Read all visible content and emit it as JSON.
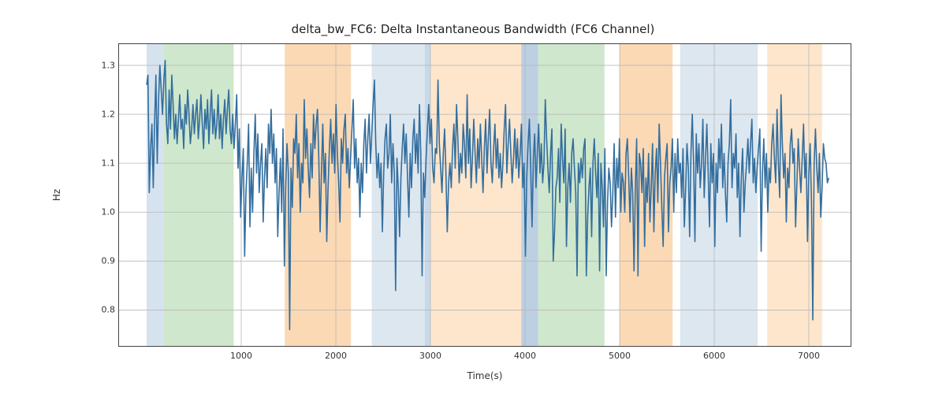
{
  "chart_data": {
    "type": "line",
    "title": "delta_bw_FC6: Delta Instantaneous Bandwidth (FC6 Channel)",
    "xlabel": "Time(s)",
    "ylabel": "Hz",
    "xlim": [
      -300,
      7450
    ],
    "ylim": [
      0.725,
      1.345
    ],
    "xticks": [
      1000,
      2000,
      3000,
      4000,
      5000,
      6000,
      7000
    ],
    "yticks": [
      0.8,
      0.9,
      1.0,
      1.1,
      1.2,
      1.3
    ],
    "grid": true,
    "bands": [
      {
        "x0": 0,
        "x1": 180,
        "color": "#d6e3ef",
        "alpha": 1.0
      },
      {
        "x0": 180,
        "x1": 920,
        "color": "#cfe7cc",
        "alpha": 1.0
      },
      {
        "x0": 1460,
        "x1": 2160,
        "color": "#fbd9b5",
        "alpha": 1.0
      },
      {
        "x0": 2380,
        "x1": 2940,
        "color": "#dde7f0",
        "alpha": 1.0
      },
      {
        "x0": 2940,
        "x1": 3000,
        "color": "#c8d8e8",
        "alpha": 1.0
      },
      {
        "x0": 3000,
        "x1": 3960,
        "color": "#fde6cc",
        "alpha": 1.0
      },
      {
        "x0": 3960,
        "x1": 4140,
        "color": "#bcd0e2",
        "alpha": 1.0
      },
      {
        "x0": 4140,
        "x1": 4840,
        "color": "#cfe7cc",
        "alpha": 1.0
      },
      {
        "x0": 5000,
        "x1": 5560,
        "color": "#fbd9b5",
        "alpha": 1.0
      },
      {
        "x0": 5640,
        "x1": 6460,
        "color": "#dde7f0",
        "alpha": 1.0
      },
      {
        "x0": 6560,
        "x1": 7140,
        "color": "#fde6cc",
        "alpha": 1.0
      }
    ],
    "series": [
      {
        "name": "delta_bw_FC6",
        "color": "#336e9e",
        "x_start": 0,
        "x_step": 14,
        "y": [
          1.26,
          1.28,
          1.04,
          1.13,
          1.18,
          1.05,
          1.18,
          1.28,
          1.1,
          1.23,
          1.3,
          1.25,
          1.2,
          1.27,
          1.31,
          1.18,
          1.14,
          1.25,
          1.17,
          1.28,
          1.22,
          1.15,
          1.2,
          1.14,
          1.19,
          1.24,
          1.17,
          1.19,
          1.13,
          1.22,
          1.18,
          1.25,
          1.2,
          1.14,
          1.17,
          1.22,
          1.16,
          1.2,
          1.23,
          1.15,
          1.19,
          1.24,
          1.18,
          1.13,
          1.21,
          1.17,
          1.23,
          1.14,
          1.2,
          1.25,
          1.16,
          1.21,
          1.15,
          1.18,
          1.24,
          1.15,
          1.2,
          1.13,
          1.19,
          1.23,
          1.16,
          1.21,
          1.25,
          1.17,
          1.14,
          1.2,
          1.13,
          1.18,
          1.24,
          1.09,
          1.17,
          0.99,
          1.07,
          1.13,
          0.91,
          1.04,
          1.1,
          1.18,
          0.97,
          1.09,
          1.0,
          1.12,
          1.2,
          1.08,
          1.16,
          1.04,
          1.1,
          1.14,
          0.98,
          1.07,
          1.13,
          1.05,
          1.18,
          1.12,
          1.21,
          1.1,
          1.16,
          1.06,
          1.13,
          0.95,
          1.04,
          1.11,
          1.0,
          1.17,
          0.89,
          1.05,
          1.14,
          1.08,
          0.76,
          1.09,
          1.01,
          1.15,
          1.12,
          1.2,
          1.07,
          1.14,
          1.0,
          1.1,
          1.06,
          1.23,
          1.11,
          1.17,
          1.09,
          1.03,
          1.14,
          1.07,
          1.2,
          1.13,
          1.18,
          1.21,
          1.11,
          0.96,
          1.08,
          1.18,
          1.06,
          1.12,
          0.94,
          1.05,
          1.13,
          1.19,
          1.1,
          1.16,
          1.08,
          1.22,
          1.12,
          1.06,
          0.98,
          1.15,
          1.1,
          1.17,
          1.2,
          1.08,
          1.13,
          1.05,
          1.11,
          1.17,
          1.23,
          1.09,
          1.15,
          1.06,
          1.11,
          0.99,
          1.1,
          1.04,
          1.14,
          1.19,
          1.08,
          1.15,
          1.2,
          1.1,
          1.16,
          1.22,
          1.27,
          1.14,
          1.07,
          1.12,
          1.05,
          1.1,
          0.96,
          1.08,
          1.15,
          1.18,
          1.09,
          1.12,
          1.2,
          1.06,
          1.14,
          1.08,
          0.84,
          1.11,
          1.05,
          0.95,
          1.07,
          1.13,
          1.18,
          1.1,
          1.16,
          1.07,
          0.99,
          1.12,
          1.05,
          1.15,
          1.19,
          1.1,
          1.16,
          1.08,
          1.22,
          1.12,
          0.87,
          1.08,
          1.03,
          1.11,
          1.17,
          1.22,
          1.14,
          1.19,
          1.09,
          1.06,
          1.13,
          1.12,
          1.27,
          1.14,
          1.09,
          1.04,
          1.12,
          1.17,
          1.08,
          0.96,
          1.06,
          1.1,
          1.05,
          1.13,
          1.18,
          1.09,
          1.22,
          1.15,
          1.06,
          1.12,
          1.08,
          1.18,
          1.14,
          1.07,
          1.24,
          1.1,
          1.17,
          1.05,
          1.11,
          1.19,
          1.12,
          1.06,
          1.15,
          1.09,
          1.18,
          1.11,
          1.04,
          1.13,
          1.19,
          1.08,
          1.15,
          1.21,
          1.1,
          1.06,
          1.13,
          1.18,
          1.09,
          1.15,
          1.07,
          1.12,
          1.05,
          1.1,
          1.17,
          1.22,
          1.08,
          1.14,
          1.19,
          1.12,
          1.06,
          1.11,
          1.17,
          1.09,
          1.15,
          1.07,
          1.12,
          1.18,
          1.05,
          1.1,
          0.91,
          1.07,
          1.14,
          1.19,
          1.09,
          0.97,
          1.11,
          1.16,
          1.05,
          1.12,
          1.18,
          1.08,
          1.14,
          1.06,
          1.1,
          1.23,
          1.15,
          1.09,
          1.04,
          1.12,
          1.17,
          0.9,
          0.96,
          1.05,
          1.07,
          1.13,
          1.02,
          1.18,
          1.11,
          1.06,
          1.17,
          0.93,
          1.05,
          1.1,
          1.02,
          1.12,
          1.15,
          1.09,
          1.04,
          0.87,
          1.1,
          1.06,
          1.11,
          1.07,
          1.13,
          1.15,
          0.87,
          0.99,
          1.05,
          1.09,
          0.95,
          1.1,
          1.15,
          1.08,
          1.03,
          1.12,
          0.88,
          1.1,
          1.05,
          0.97,
          1.13,
          0.87,
          1.02,
          1.09,
          1.06,
          0.97,
          1.04,
          1.14,
          0.99,
          1.11,
          1.05,
          1.15,
          1.0,
          1.08,
          1.06,
          1.0,
          1.12,
          1.15,
          1.07,
          0.98,
          1.09,
          1.04,
          0.88,
          1.05,
          1.15,
          0.87,
          1.12,
          1.1,
          1.04,
          1.13,
          0.93,
          1.07,
          1.02,
          1.12,
          0.98,
          1.05,
          1.14,
          0.96,
          1.08,
          1.13,
          1.02,
          1.18,
          1.1,
          1.01,
          0.93,
          1.07,
          1.11,
          1.14,
          0.96,
          1.06,
          1.09,
          1.15,
          1.0,
          1.12,
          1.04,
          1.15,
          1.08,
          1.1,
          1.03,
          1.13,
          0.97,
          1.05,
          1.14,
          1.09,
          0.95,
          1.12,
          1.2,
          1.1,
          0.94,
          1.16,
          1.08,
          1.14,
          1.05,
          1.1,
          1.19,
          1.03,
          1.11,
          1.18,
          1.08,
          0.97,
          1.14,
          1.06,
          1.12,
          0.93,
          1.1,
          1.04,
          1.15,
          1.09,
          1.18,
          1.05,
          1.12,
          1.04,
          0.98,
          1.1,
          1.14,
          1.23,
          1.05,
          1.12,
          1.09,
          1.16,
          1.03,
          1.1,
          0.95,
          1.07,
          1.13,
          1.0,
          1.06,
          1.1,
          1.15,
          1.08,
          1.14,
          1.19,
          1.06,
          1.11,
          1.04,
          1.09,
          1.13,
          1.17,
          0.92,
          1.08,
          1.15,
          1.05,
          1.12,
          1.0,
          1.09,
          1.06,
          1.14,
          1.18,
          1.11,
          1.06,
          1.21,
          1.1,
          1.03,
          1.24,
          1.14,
          1.07,
          1.12,
          0.98,
          1.09,
          1.05,
          1.14,
          1.17,
          1.1,
          1.13,
          0.97,
          1.06,
          1.15,
          1.09,
          1.04,
          1.11,
          1.18,
          1.07,
          1.12,
          0.94,
          1.08,
          1.14,
          1.02,
          0.78,
          1.1,
          1.17,
          1.09,
          1.04,
          1.12,
          0.99,
          1.05,
          1.14,
          1.11,
          1.1,
          1.06,
          1.07
        ]
      }
    ]
  }
}
